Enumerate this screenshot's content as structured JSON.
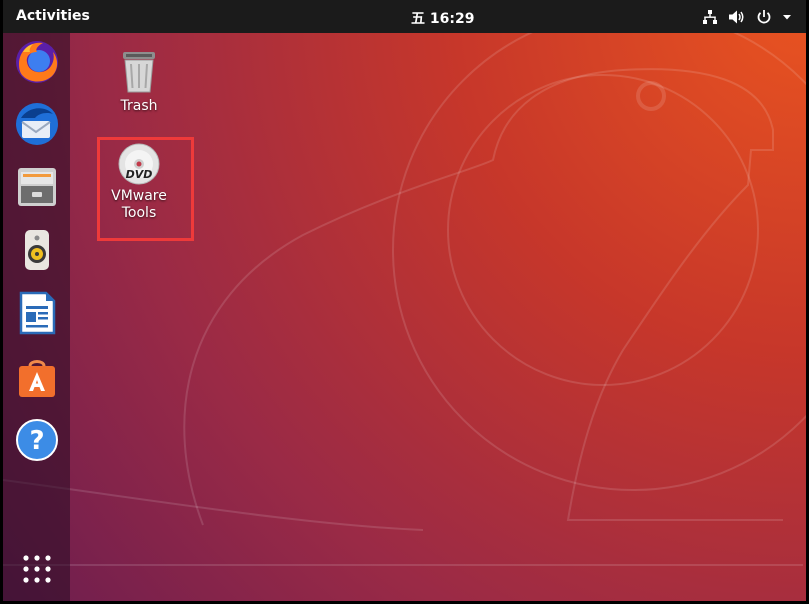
{
  "topbar": {
    "activities_label": "Activities",
    "clock": "五 16:29",
    "tray_icons": [
      "network-icon",
      "volume-icon",
      "power-icon",
      "menu-arrow-icon"
    ]
  },
  "dock": {
    "apps": [
      "firefox-icon",
      "thunderbird-icon",
      "files-icon",
      "rhythmbox-icon",
      "libreoffice-writer-icon",
      "ubuntu-software-icon",
      "help-icon"
    ],
    "show_apps_icon": "app-grid-icon"
  },
  "desktop": {
    "trash_label": "Trash",
    "vmware_label_line1": "VMware",
    "vmware_label_line2": "Tools",
    "dvd_text": "DVD"
  },
  "colors": {
    "accent": "#e95420",
    "highlight_box": "#ee3a3a",
    "topbar": "#1b1b1b"
  }
}
